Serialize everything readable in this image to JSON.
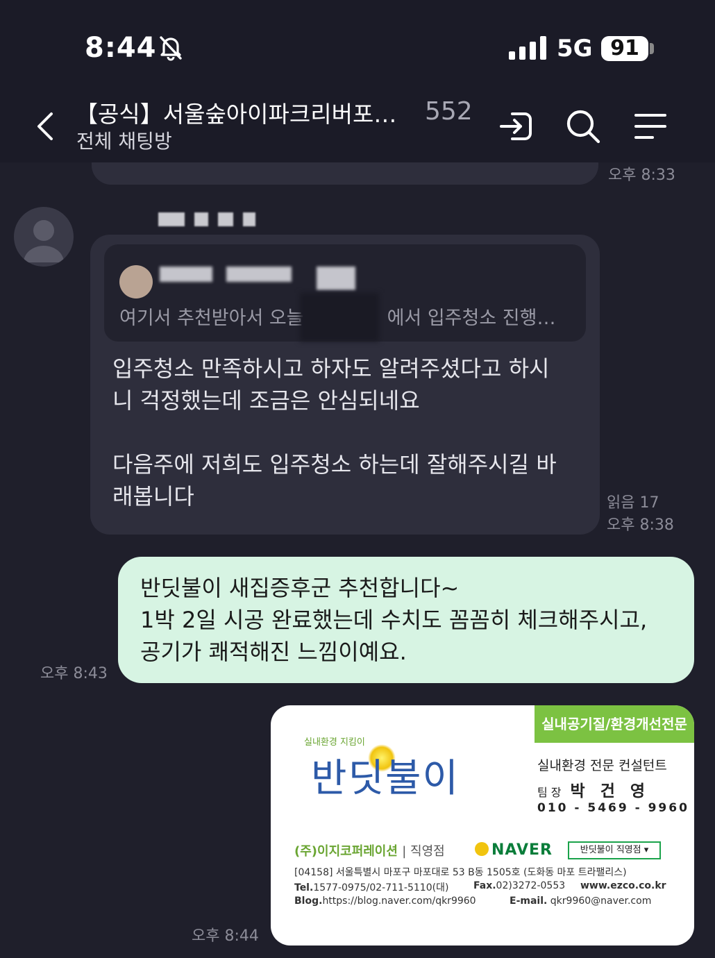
{
  "status_bar": {
    "time": "8:44",
    "network": "5G",
    "battery": "91"
  },
  "header": {
    "title": "【공식】서울숲아이파크리버포…",
    "member_count": "552",
    "subtitle": "전체 채팅방"
  },
  "messages": [
    {
      "time": "오후 8:33"
    },
    {
      "quote_text": "여기서 추천받아서 오늘",
      "quote_text_end": "에서 입주청소 진행…",
      "text_line1": "입주청소 만족하시고 하자도 알려주셨다고 하시",
      "text_line2": "니  걱정했는데 조금은 안심되네요",
      "text_line3": "다음주에 저희도 입주청소 하는데 잘해주시길 바",
      "text_line4": "래봅니다",
      "read_count": "읽음 17",
      "time": "오후 8:38"
    },
    {
      "text_line1": "반딧불이 새집증후군 추천합니다~",
      "text_line2": "1박 2일 시공 완료했는데 수치도 꼼꼼히 체크해주시고,",
      "text_line3": "공기가 쾌적해진 느낌이예요.",
      "time": "오후 8:43"
    },
    {
      "time": "오후 8:44"
    }
  ],
  "business_card": {
    "tag": "실내공기질/환경개선전문",
    "logo_small": "실내환경 지킴이",
    "logo": "반딧불이",
    "role": "실내환경 전문 컨설턴트",
    "title_label": "팀 장",
    "name": "박건영",
    "phone": "010 - 5469 - 9960",
    "company": "(주)이지코퍼레이션",
    "branch": "| 직영점",
    "naver": "NAVER",
    "naver_box": "반딧불이 직영점 ▾",
    "address": "[04158] 서울특별시 마포구 마포대로 53  B동 1505호 (도화동  마포 트라팰리스)",
    "tel_label": "Tel.",
    "tel": "1577-0975/02-711-5110(대)",
    "fax_label": "Fax.",
    "fax": "02)3272-0553",
    "web": "www.ezco.co.kr",
    "blog_label": "Blog.",
    "blog": "https://blog.naver.com/qkr9960",
    "email_label": "E-mail.",
    "email": "qkr9960@naver.com"
  },
  "icons": [
    "bell-slash-icon",
    "signal-icon",
    "back-chevron-icon",
    "enter-icon",
    "search-icon",
    "menu-icon",
    "avatar-icon"
  ],
  "colors": {
    "background": "#1f1f2b",
    "incoming_bubble": "#2e2e3c",
    "outgoing_bubble": "#d7f4e3",
    "card_accent": "#7cc242"
  }
}
